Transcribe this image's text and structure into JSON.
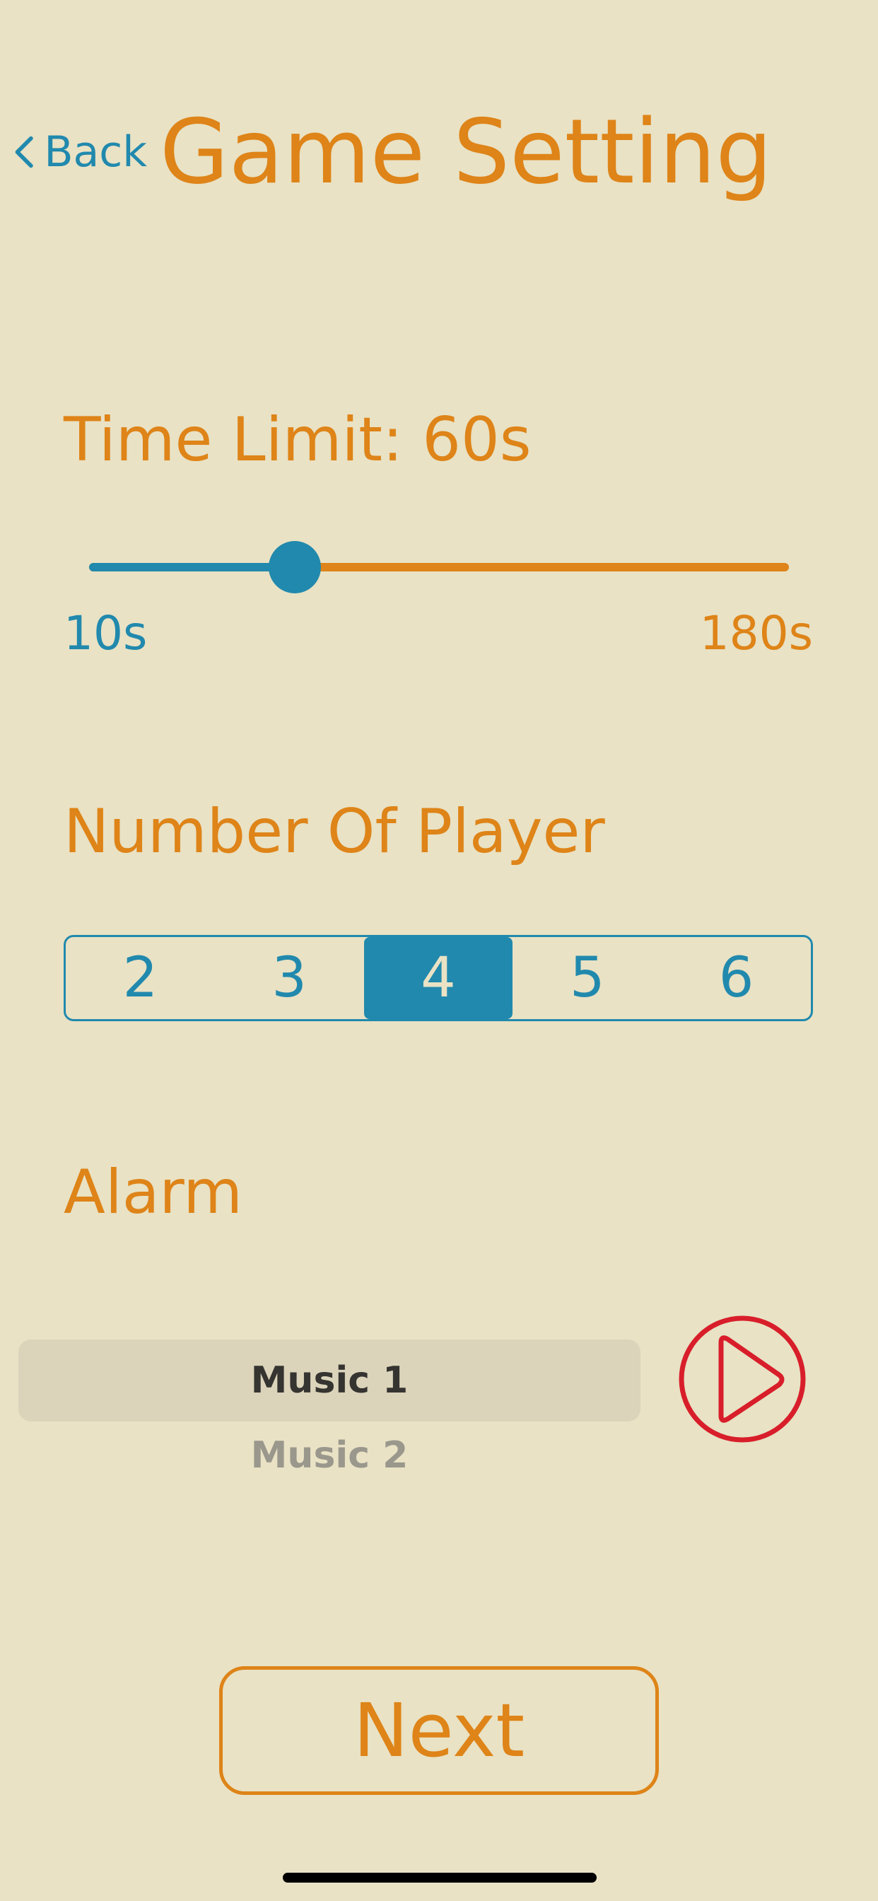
{
  "header": {
    "back_label": "Back",
    "title": "Game Setting"
  },
  "time_limit": {
    "label": "Time Limit: 60s",
    "min_label": "10s",
    "max_label": "180s",
    "value_seconds": 60,
    "min_seconds": 10,
    "max_seconds": 180
  },
  "players": {
    "label": "Number Of Player",
    "options": [
      "2",
      "3",
      "4",
      "5",
      "6"
    ],
    "selected": "4"
  },
  "alarm": {
    "label": "Alarm",
    "options": [
      "Music 1",
      "Music 2"
    ],
    "selected": "Music 1",
    "play_icon": "play-icon"
  },
  "footer": {
    "next_label": "Next"
  },
  "colors": {
    "background": "#e9e2c5",
    "accent_orange": "#de8418",
    "accent_blue": "#2189ad",
    "play_red": "#d81e2a"
  }
}
